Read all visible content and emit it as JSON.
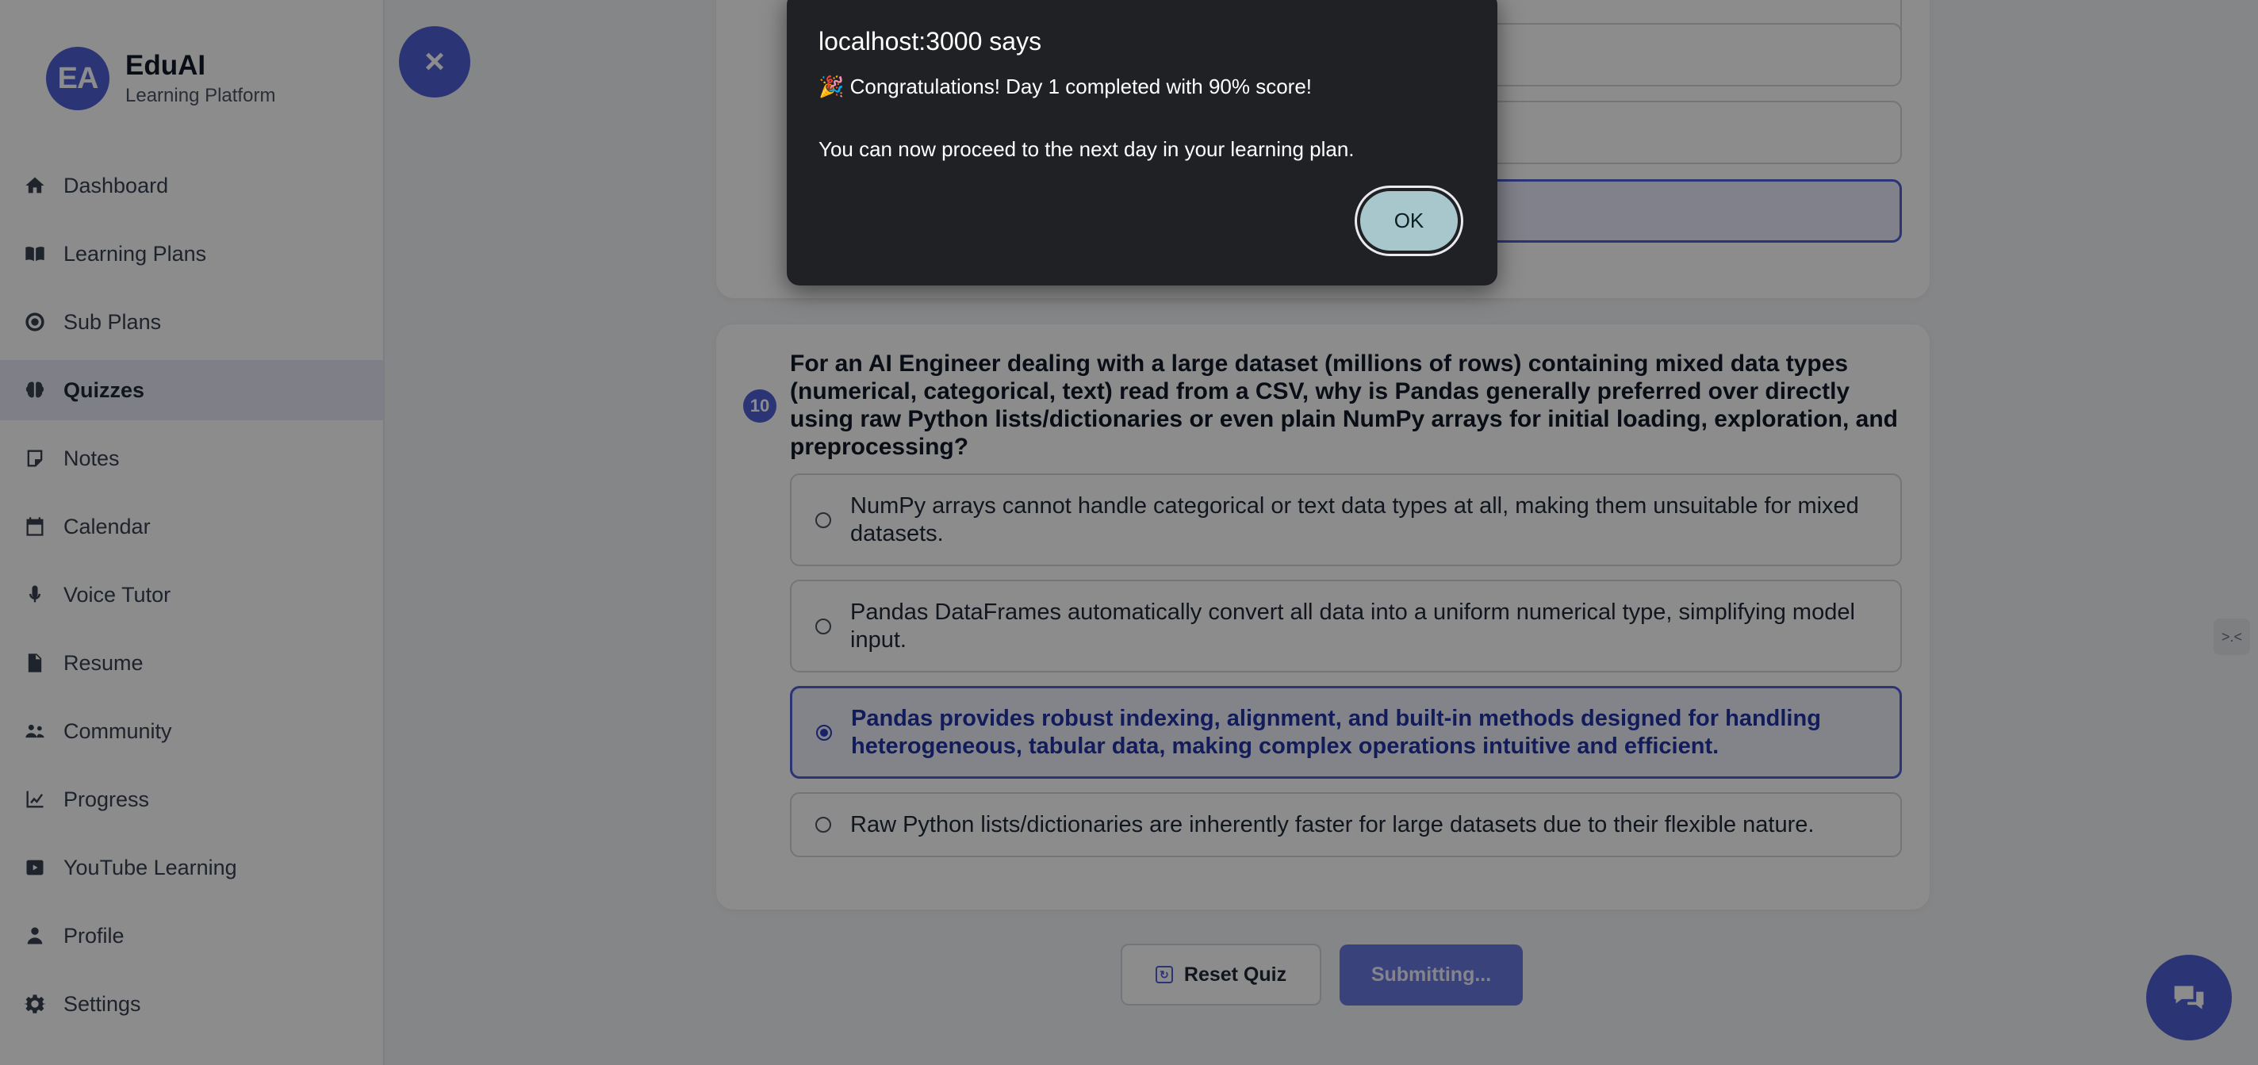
{
  "sidebar": {
    "brand": {
      "initials": "EA",
      "name": "EduAI",
      "subtitle": "Learning Platform"
    },
    "items": [
      {
        "label": "Dashboard",
        "icon": "home-icon"
      },
      {
        "label": "Learning Plans",
        "icon": "book-icon"
      },
      {
        "label": "Sub Plans",
        "icon": "target-icon"
      },
      {
        "label": "Quizzes",
        "icon": "brain-icon",
        "active": true
      },
      {
        "label": "Notes",
        "icon": "note-icon"
      },
      {
        "label": "Calendar",
        "icon": "calendar-icon"
      },
      {
        "label": "Voice Tutor",
        "icon": "microphone-icon"
      },
      {
        "label": "Resume",
        "icon": "file-icon"
      },
      {
        "label": "Community",
        "icon": "users-icon"
      },
      {
        "label": "Progress",
        "icon": "chart-line-icon"
      },
      {
        "label": "YouTube Learning",
        "icon": "youtube-icon"
      },
      {
        "label": "Profile",
        "icon": "user-icon"
      },
      {
        "label": "Settings",
        "icon": "gear-icon"
      }
    ]
  },
  "main": {
    "close_icon": "×",
    "question": {
      "number": "10",
      "text": "For an AI Engineer dealing with a large dataset (millions of rows) containing mixed data types (numerical, categorical, text) read from a CSV, why is Pandas generally preferred over directly using raw Python lists/dictionaries or even plain NumPy arrays for initial loading, exploration, and preprocessing?",
      "options": [
        {
          "text": "NumPy arrays cannot handle categorical or text data types at all, making them unsuitable for mixed datasets.",
          "selected": false
        },
        {
          "text": "Pandas DataFrames automatically convert all data into a uniform numerical type, simplifying model input.",
          "selected": false
        },
        {
          "text": "Pandas provides robust indexing, alignment, and built-in methods designed for handling heterogeneous, tabular data, making complex operations intuitive and efficient.",
          "selected": true
        },
        {
          "text": "Raw Python lists/dictionaries are inherently faster for large datasets due to their flexible nature.",
          "selected": false
        }
      ]
    },
    "buttons": {
      "reset_label": "Reset Quiz",
      "submit_label": "Submitting..."
    },
    "side_tab_glyph": ">.<"
  },
  "dialog": {
    "title": "localhost:3000 says",
    "line1": "🎉 Congratulations! Day 1 completed with 90% score!",
    "line2": "You can now proceed to the next day in your learning plan.",
    "ok_label": "OK"
  },
  "colors": {
    "accent": "#4f5fd6",
    "dialog_bg": "#202124",
    "ok_button": "#a8c7cc"
  }
}
